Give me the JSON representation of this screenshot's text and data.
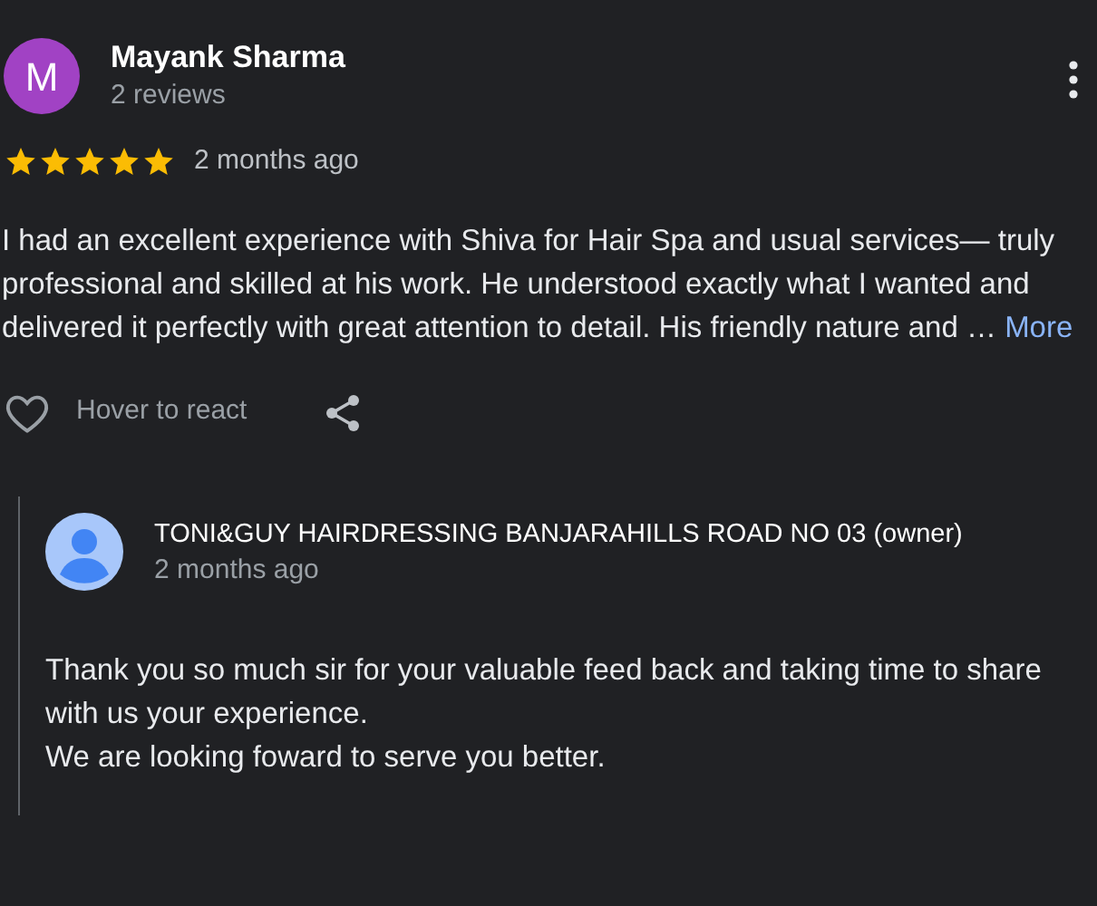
{
  "review": {
    "avatar_letter": "M",
    "author": "Mayank Sharma",
    "review_count": "2 reviews",
    "stars": 5,
    "time": "2 months ago",
    "text": "I had an excellent experience with Shiva for Hair Spa and usual services— truly professional and skilled at his work. He understood exactly what I wanted and delivered it perfectly with great attention to detail. His friendly nature and …",
    "more_link": "More",
    "react_label": "Hover to react"
  },
  "owner_reply": {
    "author": "TONI&GUY HAIRDRESSING BANJARAHILLS ROAD NO 03 (owner)",
    "time": "2 months ago",
    "lines": [
      "Thank you so much sir for your valuable feed back and taking time to share with us your experience.",
      "We are looking foward to serve you better."
    ]
  }
}
